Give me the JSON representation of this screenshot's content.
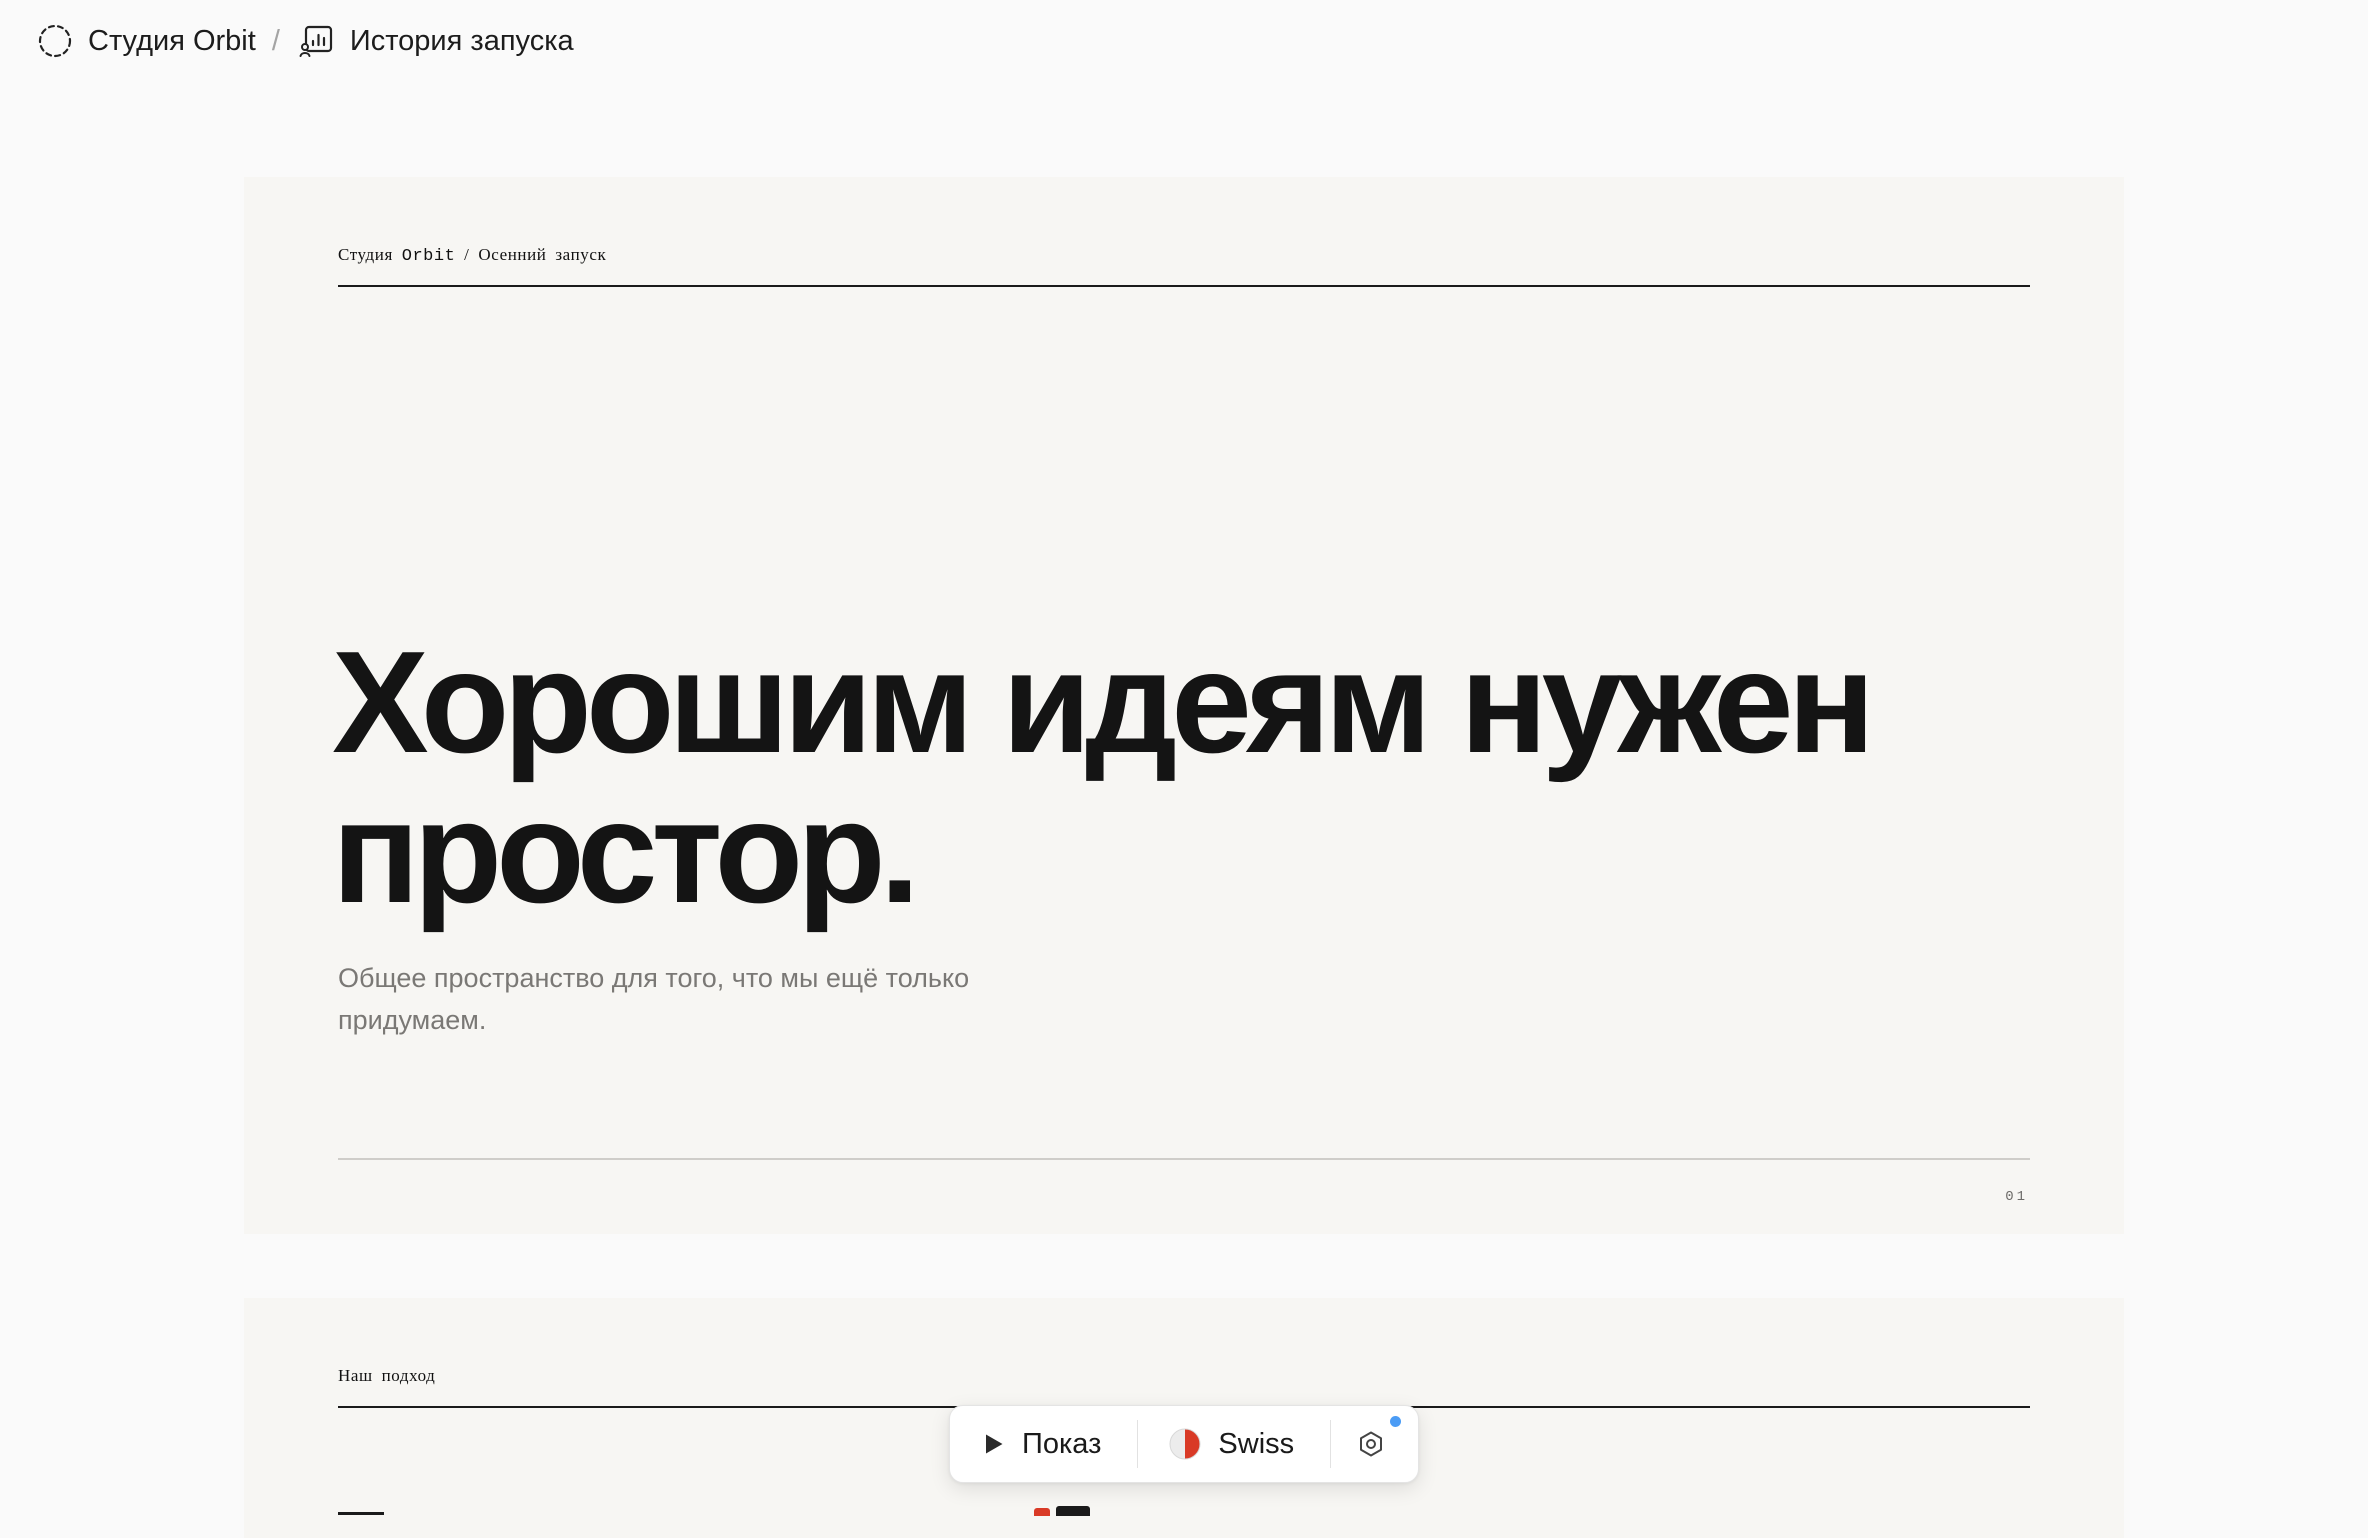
{
  "breadcrumb": {
    "workspace": "Студия Orbit",
    "separator": "/",
    "page": "История запуска"
  },
  "slides": [
    {
      "header": {
        "brand_word": "Студия",
        "brand_mono": "Orbit",
        "separator": "/",
        "section": "Осенний запуск"
      },
      "title_line_1": "Хорошим идеям нужен",
      "title_line_2": "простор.",
      "subtitle": "Общее пространство для того, что мы ещё только придумаем.",
      "page_number": "01"
    },
    {
      "header": {
        "section": "Наш подход"
      }
    }
  ],
  "toolbar": {
    "present_label": "Показ",
    "theme_label": "Swiss",
    "theme_colors": {
      "left": "#ececec",
      "right": "#d93a26"
    },
    "notification_color": "#4b9cf5"
  }
}
